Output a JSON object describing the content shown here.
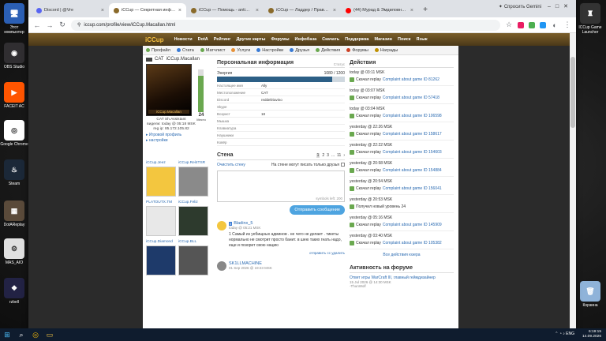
{
  "desktop": {
    "icons_left": [
      {
        "label": "Этот компьютер",
        "color": "#2b5fb4",
        "glyph": "🖥"
      },
      {
        "label": "OBS Studio",
        "color": "#302e31",
        "glyph": "◉"
      },
      {
        "label": "FACEIT AC",
        "color": "#ff5500",
        "glyph": "▶"
      },
      {
        "label": "Google Chrome",
        "color": "#ffffff",
        "glyph": "◎"
      },
      {
        "label": "Steam",
        "color": "#1b2838",
        "glyph": "♨"
      },
      {
        "label": "DotAReplay",
        "color": "#5a4a3a",
        "glyph": "▦"
      },
      {
        "label": "MAS_AIO",
        "color": "#e0e0e0",
        "glyph": "⚙"
      },
      {
        "label": "rzbell",
        "color": "#222244",
        "glyph": "❖"
      }
    ],
    "icons_right": [
      {
        "label": "ICCup Game Launcher",
        "color": "#333333",
        "glyph": "♜"
      },
      {
        "label": "Корзина",
        "color": "#8fb3d9",
        "glyph": "🗑"
      }
    ]
  },
  "browser": {
    "tabs": [
      {
        "title": "Discord | @Vre",
        "fav_color": "#5865f2",
        "active": false
      },
      {
        "title": "iCCup — Секретная информац",
        "fav_color": "#8a6a2a",
        "active": true
      },
      {
        "title": "iCCup — Помощь - antimag",
        "fav_color": "#8a6a2a",
        "active": false
      },
      {
        "title": "iCCup — Ладдер / Правила ма",
        "fav_color": "#8a6a2a",
        "active": false
      },
      {
        "title": "(44) Мурад & Эмдиловна - Фол",
        "fav_color": "#ff0000",
        "active": false
      }
    ],
    "gemini_label": "Спросить Gemini",
    "url": "iccup.com/profile/view/iCCup.Macallan.html"
  },
  "site": {
    "logo": "iCCup",
    "topnav": [
      "Новости",
      "DotA",
      "Рейтинг",
      "Другие карты",
      "Форумы",
      "Инфобаза",
      "Скачать",
      "Поддержка",
      "Магазин",
      "Поиск",
      "Язык"
    ],
    "subnav": [
      {
        "label": "Профайл",
        "color": "#6aa84f"
      },
      {
        "label": "Стата",
        "color": "#3a7bd5"
      },
      {
        "label": "Матчлист",
        "color": "#6aa84f"
      },
      {
        "label": "Услуги",
        "color": "#e69138"
      },
      {
        "label": "Настройки",
        "color": "#3a7bd5"
      },
      {
        "label": "Друзья",
        "color": "#3a7bd5"
      },
      {
        "label": "Действия",
        "color": "#6aa84f"
      },
      {
        "label": "Форумы",
        "color": "#cc4125"
      },
      {
        "label": "Награды",
        "color": "#bf9000"
      }
    ]
  },
  "profile": {
    "name": "iCCup.Macallan",
    "country": "CAT",
    "avatar_caption": "iCCup.Macallan",
    "rank_value": "24",
    "rank_label": "Место",
    "meter_fraction": 0.85,
    "info_lines": [
      "CAT Sh.Assistant",
      "видели: today @ 05:18 MSK",
      "reg ip: 85.172.105.82"
    ],
    "links": [
      "Игровой профиль",
      "настройки"
    ],
    "friends": [
      {
        "name": "iCCup.Jeez",
        "color": "#f3c63f"
      },
      {
        "name": "iCCup.Rel4TSR",
        "color": "#8a8a8a"
      },
      {
        "name": "PLATOUTX.TM",
        "color": "#e8e8e8"
      },
      {
        "name": "iCCup.Feliz",
        "color": "#2d3a2d"
      },
      {
        "name": "iCCup.Diamond",
        "color": "#1e3a6a"
      },
      {
        "name": "iCCup.BLL",
        "color": "#555555"
      }
    ]
  },
  "personal": {
    "title": "Персональная информация",
    "status": "Статус",
    "energy_label": "Энергия",
    "energy_value": "1080 / 1200",
    "energy_fraction": 0.9,
    "rows": [
      {
        "k": "Настоящее имя",
        "v": "Ally"
      },
      {
        "k": "Местоположение",
        "v": "CAT"
      },
      {
        "k": "Discord",
        "v": "reddeliriavino"
      },
      {
        "k": "Skype",
        "v": ""
      },
      {
        "k": "Возраст",
        "v": "18"
      },
      {
        "k": "Мышка",
        "v": ""
      },
      {
        "k": "Клавиатура",
        "v": ""
      },
      {
        "k": "Наушники",
        "v": ""
      },
      {
        "k": "Ковёр",
        "v": ""
      }
    ]
  },
  "wall": {
    "title": "Стена",
    "pager": [
      "1",
      "2",
      "3",
      "...",
      "11",
      "›"
    ],
    "clear_label": "Очистить стену",
    "nowrite_label": "На стене могут писать только друзья",
    "symbols_left": "symbols left: 200",
    "send_label": "Отправить сообщение",
    "posts": [
      {
        "author": "Bladinx_5",
        "level": "5",
        "date": "today @ 05:21 MSK",
        "avatar_color": "#f3c63f",
        "text": "1 Самый из уебищных админов . не чего не делает . тикеты нормально не смотрит просто банит. в шею таких гнать надо, еще и позорит свою нацию",
        "actions": "отправить сс  удалить"
      },
      {
        "author": "SK1LLMACHINE",
        "level": "",
        "date": "01 Sep 2026 @ 19:23 MSK",
        "avatar_color": "#888888",
        "text": "",
        "actions": ""
      }
    ]
  },
  "actions": {
    "title": "Действия",
    "items": [
      {
        "date": "today @ 03:11 MSK",
        "prefix": "Скачал replay",
        "link": "Complaint about game ID 81262"
      },
      {
        "date": "today @ 03:07 MSK",
        "prefix": "Скачал replay",
        "link": "Complaint about game ID 57418"
      },
      {
        "date": "today @ 03:04 MSK",
        "prefix": "Скачал replay",
        "link": "Complaint about game ID 106598"
      },
      {
        "date": "yesterday @ 22:26 MSK",
        "prefix": "Скачал replay",
        "link": "Complaint about game ID 158617"
      },
      {
        "date": "yesterday @ 22:22 MSK",
        "prefix": "Скачал replay",
        "link": "Complaint about game ID 154603"
      },
      {
        "date": "yesterday @ 20:58 MSK",
        "prefix": "Скачал replay",
        "link": "Complaint about game ID 154884"
      },
      {
        "date": "yesterday @ 20:54 MSK",
        "prefix": "Скачал replay",
        "link": "Complaint about game ID 156041"
      },
      {
        "date": "yesterday @ 20:53 MSK",
        "prefix": "Получил новый уровень 24",
        "link": ""
      },
      {
        "date": "yesterday @ 05:16 MSK",
        "prefix": "Скачал replay",
        "link": "Complaint about game ID 145909"
      },
      {
        "date": "yesterday @ 03:40 MSK",
        "prefix": "Скачал replay",
        "link": "Complaint about game ID 105382"
      }
    ],
    "all_label": "Все действия юзера"
  },
  "forum": {
    "title": "Активность на форуме",
    "post_title": "Ответ игры WarCraft III, главный геймдизайнер",
    "post_date": "15 Jul 2026 @ 14:30 MSK",
    "post_author": "-ThunWolf"
  },
  "taskbar": {
    "lang": "ENG",
    "time": "6:19:15",
    "date": "14.09.2026"
  }
}
